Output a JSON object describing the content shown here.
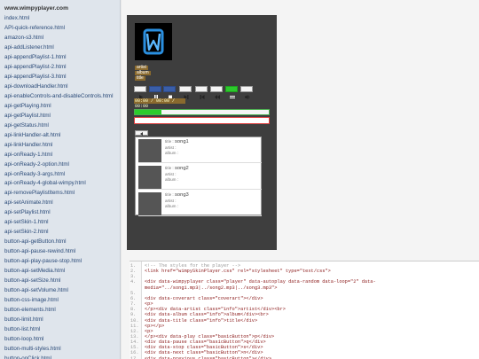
{
  "sidebar": {
    "title": "www.wimpyplayer.com",
    "links": [
      "index.html",
      "API-quick-reference.html",
      "amazon-s3.html",
      "api-addListener.html",
      "api-appendPlaylist-1.html",
      "api-appendPlaylist-2.html",
      "api-appendPlaylist-3.html",
      "api-downloadHandler.html",
      "api-enableControls-and-disableControls.html",
      "api-getPlaying.html",
      "api-getPlaylist.html",
      "api-getStatus.html",
      "api-linkHandler-alt.html",
      "api-linkHandler.html",
      "api-onReady-1.html",
      "api-onReady-2-option.html",
      "api-onReady-3-args.html",
      "api-onReady-4-global-wimpy.html",
      "api-removePlaylistItems.html",
      "api-setAnimate.html",
      "api-setPlaylist.html",
      "api-setSkin-1.html",
      "api-setSkin-2.html",
      "button-api-getButton.html",
      "button-api-pause-rewind.html",
      "button-api-play-pause-stop.html",
      "button-api-setMedia.html",
      "button-api-setSize.html",
      "button-api-setVolume.html",
      "button-css-image.html",
      "button-elements.html",
      "button-limit.html",
      "button-list.html",
      "button-loop.html",
      "button-multi-styles.html",
      "button-onClick.html"
    ]
  },
  "player": {
    "logo_letter": "W",
    "meta": {
      "artist": "artist",
      "album": "album",
      "title": "title"
    },
    "time_display": "00:00 / 00:00 / 00:00",
    "progress_fraction": 0.2,
    "controls": [
      {
        "name": "play-button",
        "style": "plain",
        "icon": "play-icon"
      },
      {
        "name": "pause-button",
        "style": "blue",
        "icon": "pause-icon"
      },
      {
        "name": "stop-button",
        "style": "blue",
        "icon": "stop-icon"
      },
      {
        "name": "next-button",
        "style": "plain",
        "icon": "next-icon"
      },
      {
        "name": "previous-button",
        "style": "plain",
        "icon": "previous-icon"
      },
      {
        "name": "rewind-button",
        "style": "plain",
        "icon": "rewind-icon"
      },
      {
        "name": "shuffle-button",
        "style": "green",
        "icon": "shuffle-icon"
      },
      {
        "name": "mute-button",
        "style": "plain",
        "icon": "speaker-icon"
      }
    ],
    "playlist": [
      {
        "title_label": "title :",
        "title": "song1",
        "artist_label": "artist :",
        "album_label": "album :"
      },
      {
        "title_label": "title :",
        "title": "song2",
        "artist_label": "artist :",
        "album_label": "album :"
      },
      {
        "title_label": "title :",
        "title": "song3",
        "artist_label": "artist :",
        "album_label": "album :"
      }
    ]
  },
  "code": {
    "lines": [
      {
        "n": "1.",
        "t": "<!-- The styles for the player -->",
        "type": "comment"
      },
      {
        "n": "2.",
        "t": "  <link href=\"wimpySkinPlayer.css\" rel=\"stylesheet\" type=\"text/css\">",
        "type": "code"
      },
      {
        "n": "3.",
        "t": "",
        "type": "code"
      },
      {
        "n": "4.",
        "t": "    <div data-wimpyplayer class=\"player\" data-autoplay data-random data-loop=\"2\" data-",
        "type": "code"
      },
      {
        "n": "",
        "t": "media=\"../song1.mp3|../song2.mp3|../song3.mp3\">",
        "type": "code"
      },
      {
        "n": "5.",
        "t": "",
        "type": "code"
      },
      {
        "n": "6.",
        "t": "      <div data-coverart class=\"coverart\"></div>",
        "type": "code"
      },
      {
        "n": "7.",
        "t": "      <p>",
        "type": "code"
      },
      {
        "n": "8.",
        "t": "        </p><div data-artist class=\"info\">artist</div><br>",
        "type": "code"
      },
      {
        "n": "9.",
        "t": "        <div data-album class=\"info\">album</div><br>",
        "type": "code"
      },
      {
        "n": "10.",
        "t": "        <div data-title class=\"info\">title</div>",
        "type": "code"
      },
      {
        "n": "11.",
        "t": "      <p></p>",
        "type": "code"
      },
      {
        "n": "12.",
        "t": "      <p>",
        "type": "code"
      },
      {
        "n": "13.",
        "t": "        </p><div data-play class=\"basicButton\">p</div>",
        "type": "code"
      },
      {
        "n": "14.",
        "t": "        <div data-pause class=\"basicButton\">q</div>",
        "type": "code"
      },
      {
        "n": "15.",
        "t": "        <div data-stop class=\"basicButton\">s</div>",
        "type": "code"
      },
      {
        "n": "16.",
        "t": "        <div data-next class=\"basicButton\">n</div>",
        "type": "code"
      },
      {
        "n": "17.",
        "t": "        <div data-previous class=\"basicButton\"></div>",
        "type": "code"
      }
    ]
  }
}
